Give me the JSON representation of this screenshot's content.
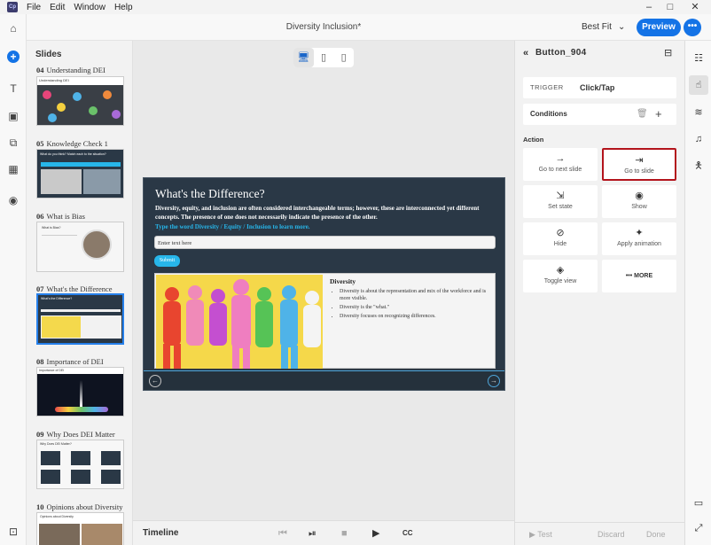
{
  "menu": {
    "items": [
      "File",
      "Edit",
      "Window",
      "Help"
    ],
    "logo": "Cp"
  },
  "window_controls": {
    "minimize": "–",
    "maximize": "□",
    "close": "✕"
  },
  "header": {
    "doc_title": "Diversity Inclusion*",
    "zoom_label": "Best Fit",
    "zoom_chevron": "⌄",
    "preview_label": "Preview",
    "more_label": "•••"
  },
  "left_toolbar": {
    "icons": [
      {
        "name": "home-icon",
        "glyph": "⌂"
      },
      {
        "name": "add-icon",
        "glyph": "+"
      },
      {
        "name": "text-icon",
        "glyph": "T"
      },
      {
        "name": "media-icon",
        "glyph": "▣"
      },
      {
        "name": "interaction-icon",
        "glyph": "⧉"
      },
      {
        "name": "widgets-icon",
        "glyph": "▦"
      },
      {
        "name": "record-icon",
        "glyph": "◉"
      },
      {
        "name": "book-icon",
        "glyph": "⊡"
      }
    ]
  },
  "slides_panel": {
    "heading": "Slides",
    "slides": [
      {
        "num": "04",
        "title": "Understanding DEI"
      },
      {
        "num": "05",
        "title": "Knowledge Check 1"
      },
      {
        "num": "06",
        "title": "What is Bias"
      },
      {
        "num": "07",
        "title": "What's the Difference"
      },
      {
        "num": "08",
        "title": "Importance of DEI"
      },
      {
        "num": "09",
        "title": "Why Does DEI Matter"
      },
      {
        "num": "10",
        "title": "Opinions about Diversity"
      }
    ],
    "thumb_text": {
      "s04": "Understanding DEI",
      "s05": "What do you think? Match each to the situation?",
      "s06": "What is Bias?",
      "s08": "Importance of DEI",
      "s09": "Why Does DEI Matter?",
      "s10": "Opinions about Diversity"
    }
  },
  "canvas": {
    "devices": [
      "🖥",
      "▯",
      "▯"
    ],
    "slide": {
      "title": "What's the Difference?",
      "paragraph": "Diversity, equity, and inclusion are often considered interchangeable terms; however, these are interconnected yet different concepts. The presence of one does not necessarily indicate the presence of the other.",
      "instruction": "Type the word Diversity / Equity / Inclusion to learn more.",
      "input_placeholder": "Enter text here",
      "submit_label": "Submit",
      "card_heading": "Diversity",
      "card_bullets": [
        "Diversity is about the representation and mix of the workforce and is more visible.",
        "Diversity is the \"what.\"",
        "Diversity focuses on recognizing differences."
      ],
      "nav_prev": "←",
      "nav_next": "→"
    }
  },
  "timeline": {
    "label": "Timeline",
    "controls": [
      "⏮",
      "⏯",
      "■",
      "▶",
      "CC"
    ]
  },
  "props": {
    "back_glyph": "«",
    "title": "Button_904",
    "monitor_glyph": "⊟",
    "trigger_label": "TRIGGER",
    "trigger_value": "Click/Tap",
    "conditions_label": "Conditions",
    "trash_glyph": "🗑",
    "plus_glyph": "+",
    "action_label": "Action",
    "actions": [
      {
        "icon": "→",
        "label": "Go to next slide"
      },
      {
        "icon": "⇥",
        "label": "Go to slide"
      },
      {
        "icon": "⇲",
        "label": "Set state"
      },
      {
        "icon": "◉",
        "label": "Show"
      },
      {
        "icon": "⊘",
        "label": "Hide"
      },
      {
        "icon": "✦",
        "label": "Apply animation"
      },
      {
        "icon": "◈",
        "label": "Toggle view"
      },
      {
        "icon": "•••",
        "label": "MORE"
      }
    ],
    "footer": {
      "test": "▶  Test",
      "discard": "Discard",
      "done": "Done"
    }
  },
  "rail": {
    "icons": [
      "☷",
      "☝",
      "≋",
      "♫",
      "🯅",
      "▭",
      "⤢"
    ]
  },
  "colors": {
    "accent": "#1473e6",
    "selection": "#b3141c",
    "slide_bg": "#2a3846",
    "highlight": "#27b6ea"
  }
}
